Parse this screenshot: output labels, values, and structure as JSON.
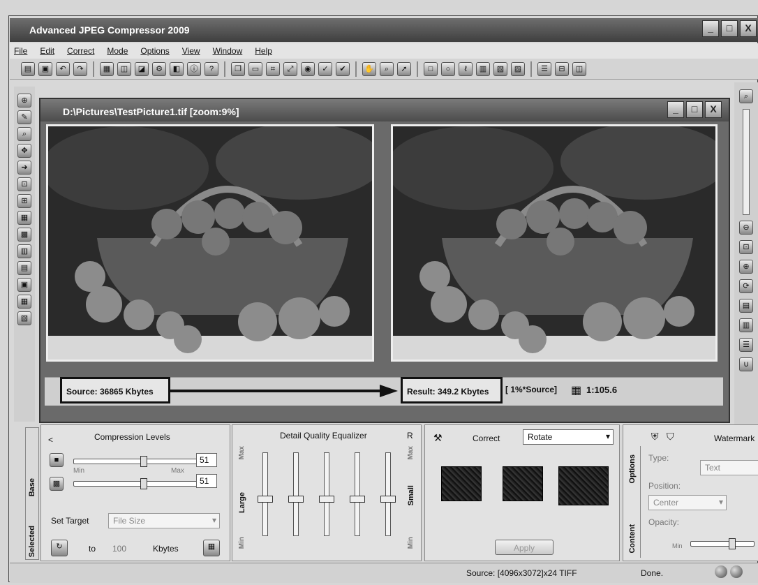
{
  "app": {
    "title": "Advanced JPEG Compressor 2009",
    "window_buttons": [
      "_",
      "□",
      "X"
    ]
  },
  "menu": [
    "File",
    "Edit",
    "Correct",
    "Mode",
    "Options",
    "View",
    "Window",
    "Help"
  ],
  "document": {
    "title": "D:\\Pictures\\TestPicture1.tif  [zoom:9%]",
    "source_label": "Source: 36865 Kbytes",
    "result_label": "Result: 349.2 Kbytes",
    "percent_label": "[ 1%*Source]",
    "ratio_label": "1:105.6"
  },
  "compression": {
    "title": "Compression Levels",
    "value1": "51",
    "value2": "51",
    "min_label": "Min",
    "max_label": "Max",
    "set_target_label": "Set Target",
    "target_select": "File Size",
    "to_label": "to",
    "to_value": "100",
    "unit_label": "Kbytes",
    "slider1_level": 0.55,
    "slider2_level": 0.55
  },
  "equalizer": {
    "title": "Detail Quality Equalizer",
    "r_label": "R",
    "max_label": "Max",
    "min_label": "Min",
    "large_label": "Large",
    "small_label": "Small"
  },
  "correct": {
    "label": "Correct",
    "select": "Rotate",
    "apply_label": "Apply"
  },
  "watermark": {
    "title": "Watermark",
    "type_label": "Type:",
    "type_value": "Text",
    "position_label": "Position:",
    "position_value": "Center",
    "opacity_label": "Opacity:",
    "opacity_min": "Min",
    "tab_options": "Options",
    "tab_content": "Content"
  },
  "left_tabs": {
    "base": "Base",
    "selected": "Selected"
  },
  "statusbar": {
    "source_info": "Source: [4096x3072]x24 TIFF",
    "status": "Done."
  }
}
